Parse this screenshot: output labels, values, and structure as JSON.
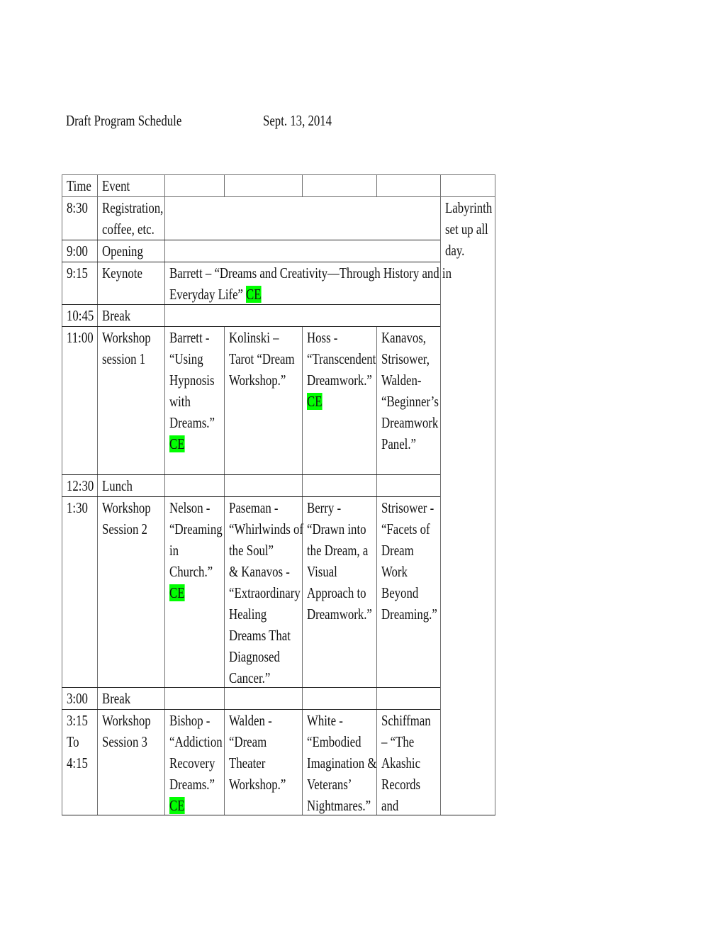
{
  "header": {
    "title": "Draft Program Schedule",
    "date": "Sept. 13, 2014"
  },
  "table": {
    "columns": [
      "Time",
      "Event",
      "",
      "",
      "",
      "",
      ""
    ],
    "side_note": [
      "Labyrinth",
      "set up all",
      "day."
    ],
    "ce_label": "CE",
    "ce_color": "#00ff00",
    "rows": [
      {
        "time": [
          "8:30"
        ],
        "event": [
          "Registration,",
          "coffee, etc."
        ]
      },
      {
        "time": [
          "9:00"
        ],
        "event": [
          "Opening"
        ]
      },
      {
        "time": [
          "9:15"
        ],
        "event": [
          "Keynote"
        ],
        "keynote": [
          "Barrett – “Dreams and Creativity—Through History and in",
          "Everyday Life”"
        ],
        "keynote_ce": true
      },
      {
        "time": [
          "10:45"
        ],
        "event": [
          "Break"
        ]
      },
      {
        "time": [
          "11:00"
        ],
        "event": [
          "Workshop",
          "session 1"
        ],
        "sessions": [
          {
            "lines": [
              "Barrett -",
              "“Using",
              "Hypnosis",
              "with",
              "Dreams.”"
            ],
            "ce": true
          },
          {
            "lines": [
              "Kolinski –",
              "Tarot “Dream",
              "Workshop.”"
            ],
            "ce": false
          },
          {
            "lines": [
              "Hoss -",
              "“Transcendent",
              "Dreamwork.”"
            ],
            "ce": true
          },
          {
            "lines": [
              "Kanavos,",
              "Strisower,",
              "Walden-",
              "“Beginner’s",
              "Dreamwork",
              "Panel.”"
            ],
            "ce": false
          }
        ]
      },
      {
        "time": [
          "12:30"
        ],
        "event": [
          "Lunch"
        ]
      },
      {
        "time": [
          "1:30"
        ],
        "event": [
          "Workshop",
          "Session 2"
        ],
        "sessions": [
          {
            "lines": [
              "Nelson -",
              "“Dreaming",
              "in",
              "Church.”"
            ],
            "ce": true
          },
          {
            "lines": [
              "Paseman -",
              "“Whirlwinds of",
              "the Soul”",
              "& Kanavos -",
              "“Extraordinary",
              "Healing",
              "Dreams That",
              "Diagnosed",
              "Cancer.”"
            ],
            "ce": false
          },
          {
            "lines": [
              "Berry -",
              "“Drawn into",
              "the Dream, a",
              "Visual",
              "Approach to",
              "Dreamwork.”"
            ],
            "ce": false
          },
          {
            "lines": [
              "Strisower -",
              "“Facets of",
              "Dream",
              "Work",
              "Beyond",
              "Dreaming.”"
            ],
            "ce": false
          }
        ]
      },
      {
        "time": [
          "3:00"
        ],
        "event": [
          "Break"
        ]
      },
      {
        "time": [
          "3:15",
          "To",
          "4:15"
        ],
        "event": [
          "Workshop",
          "Session 3"
        ],
        "sessions": [
          {
            "lines": [
              "Bishop -",
              "“Addiction",
              "Recovery",
              "Dreams.”"
            ],
            "ce": true
          },
          {
            "lines": [
              "Walden -",
              "“Dream",
              "Theater",
              "Workshop.”"
            ],
            "ce": false
          },
          {
            "lines": [
              "White -",
              "“Embodied",
              "Imagination &",
              "Veterans’",
              "Nightmares.”"
            ],
            "ce": false
          },
          {
            "lines": [
              "Schiffman",
              "– “The",
              "Akashic",
              "Records",
              "and"
            ],
            "ce": false
          }
        ]
      }
    ]
  }
}
